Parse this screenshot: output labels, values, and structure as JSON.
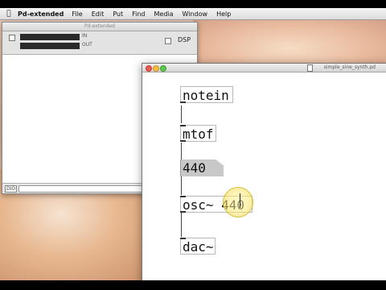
{
  "menubar": {
    "app_name": "Pd-extended",
    "items": [
      "File",
      "Edit",
      "Put",
      "Find",
      "Media",
      "Window",
      "Help"
    ]
  },
  "pd_window": {
    "title": "Pd-extended",
    "meter_in_label": "IN",
    "meter_out_label": "OUT",
    "dsp_label": "DSP",
    "console_tag": "DIO"
  },
  "patch_window": {
    "title": "simple_sine_synth.pd",
    "objects": {
      "notein": "notein",
      "mtof": "mtof",
      "message": "440",
      "osc": "osc~ 440",
      "dac": "dac~"
    }
  }
}
